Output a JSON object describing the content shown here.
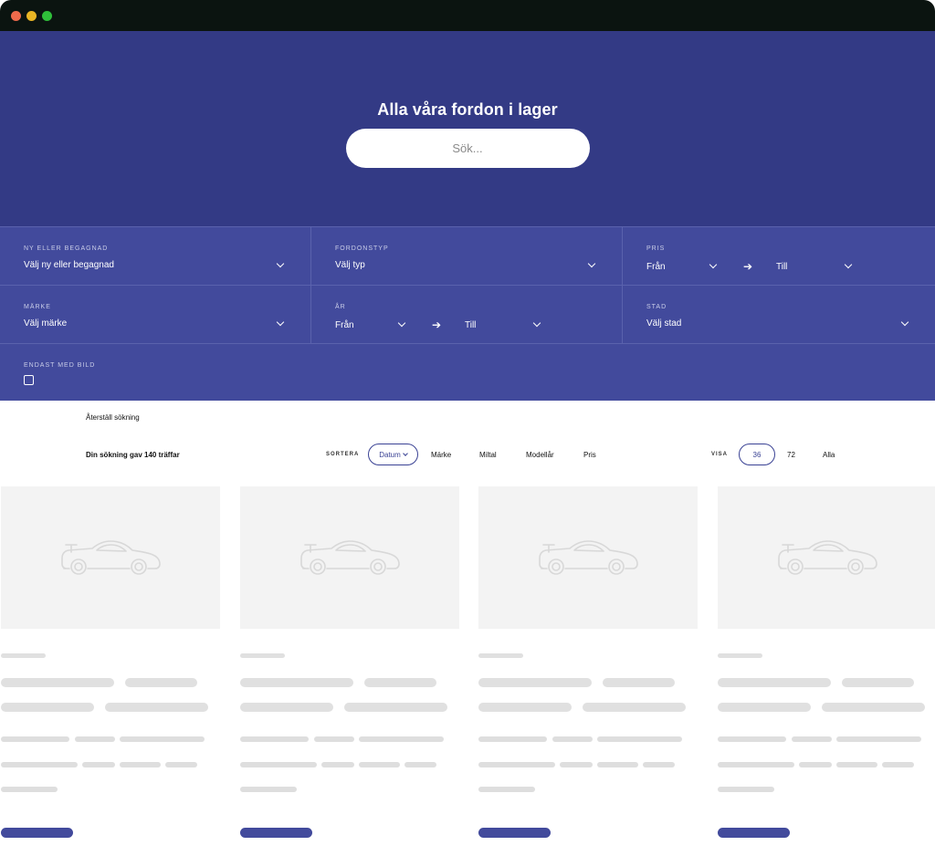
{
  "hero": {
    "title": "Alla våra fordon i lager",
    "search_placeholder": "Sök..."
  },
  "filters": {
    "condition": {
      "label": "NY ELLER BEGAGNAD",
      "value": "Välj ny eller begagnad"
    },
    "vehicle_type": {
      "label": "FORDONSTYP",
      "value": "Välj typ"
    },
    "price": {
      "label": "PRIS",
      "from": "Från",
      "to": "Till"
    },
    "brand": {
      "label": "MÄRKE",
      "value": "Välj märke"
    },
    "year": {
      "label": "ÅR",
      "from": "Från",
      "to": "Till"
    },
    "city": {
      "label": "STAD",
      "value": "Välj stad"
    },
    "with_image": {
      "label": "ENDAST MED BILD",
      "checked": false
    }
  },
  "toolbar": {
    "reset_label": "Återställ sökning",
    "results_text": "Din sökning gav 140 träffar",
    "sort_label": "SORTERA",
    "sort_options": [
      "Datum",
      "Märke",
      "Miltal",
      "Modellår",
      "Pris"
    ],
    "sort_selected": "Datum",
    "show_label": "VISA",
    "show_options": [
      "36",
      "72",
      "Alla"
    ],
    "show_selected": "36"
  },
  "colors": {
    "hero_bg": "#333a85",
    "filters_bg": "#424a9c",
    "accent": "#424a9c",
    "placeholder_bg": "#f3f3f3",
    "skeleton": "#e0e0e0"
  },
  "cards": [
    {
      "image_icon": "car-placeholder-icon"
    },
    {
      "image_icon": "car-placeholder-icon"
    },
    {
      "image_icon": "car-placeholder-icon"
    },
    {
      "image_icon": "car-placeholder-icon"
    }
  ]
}
